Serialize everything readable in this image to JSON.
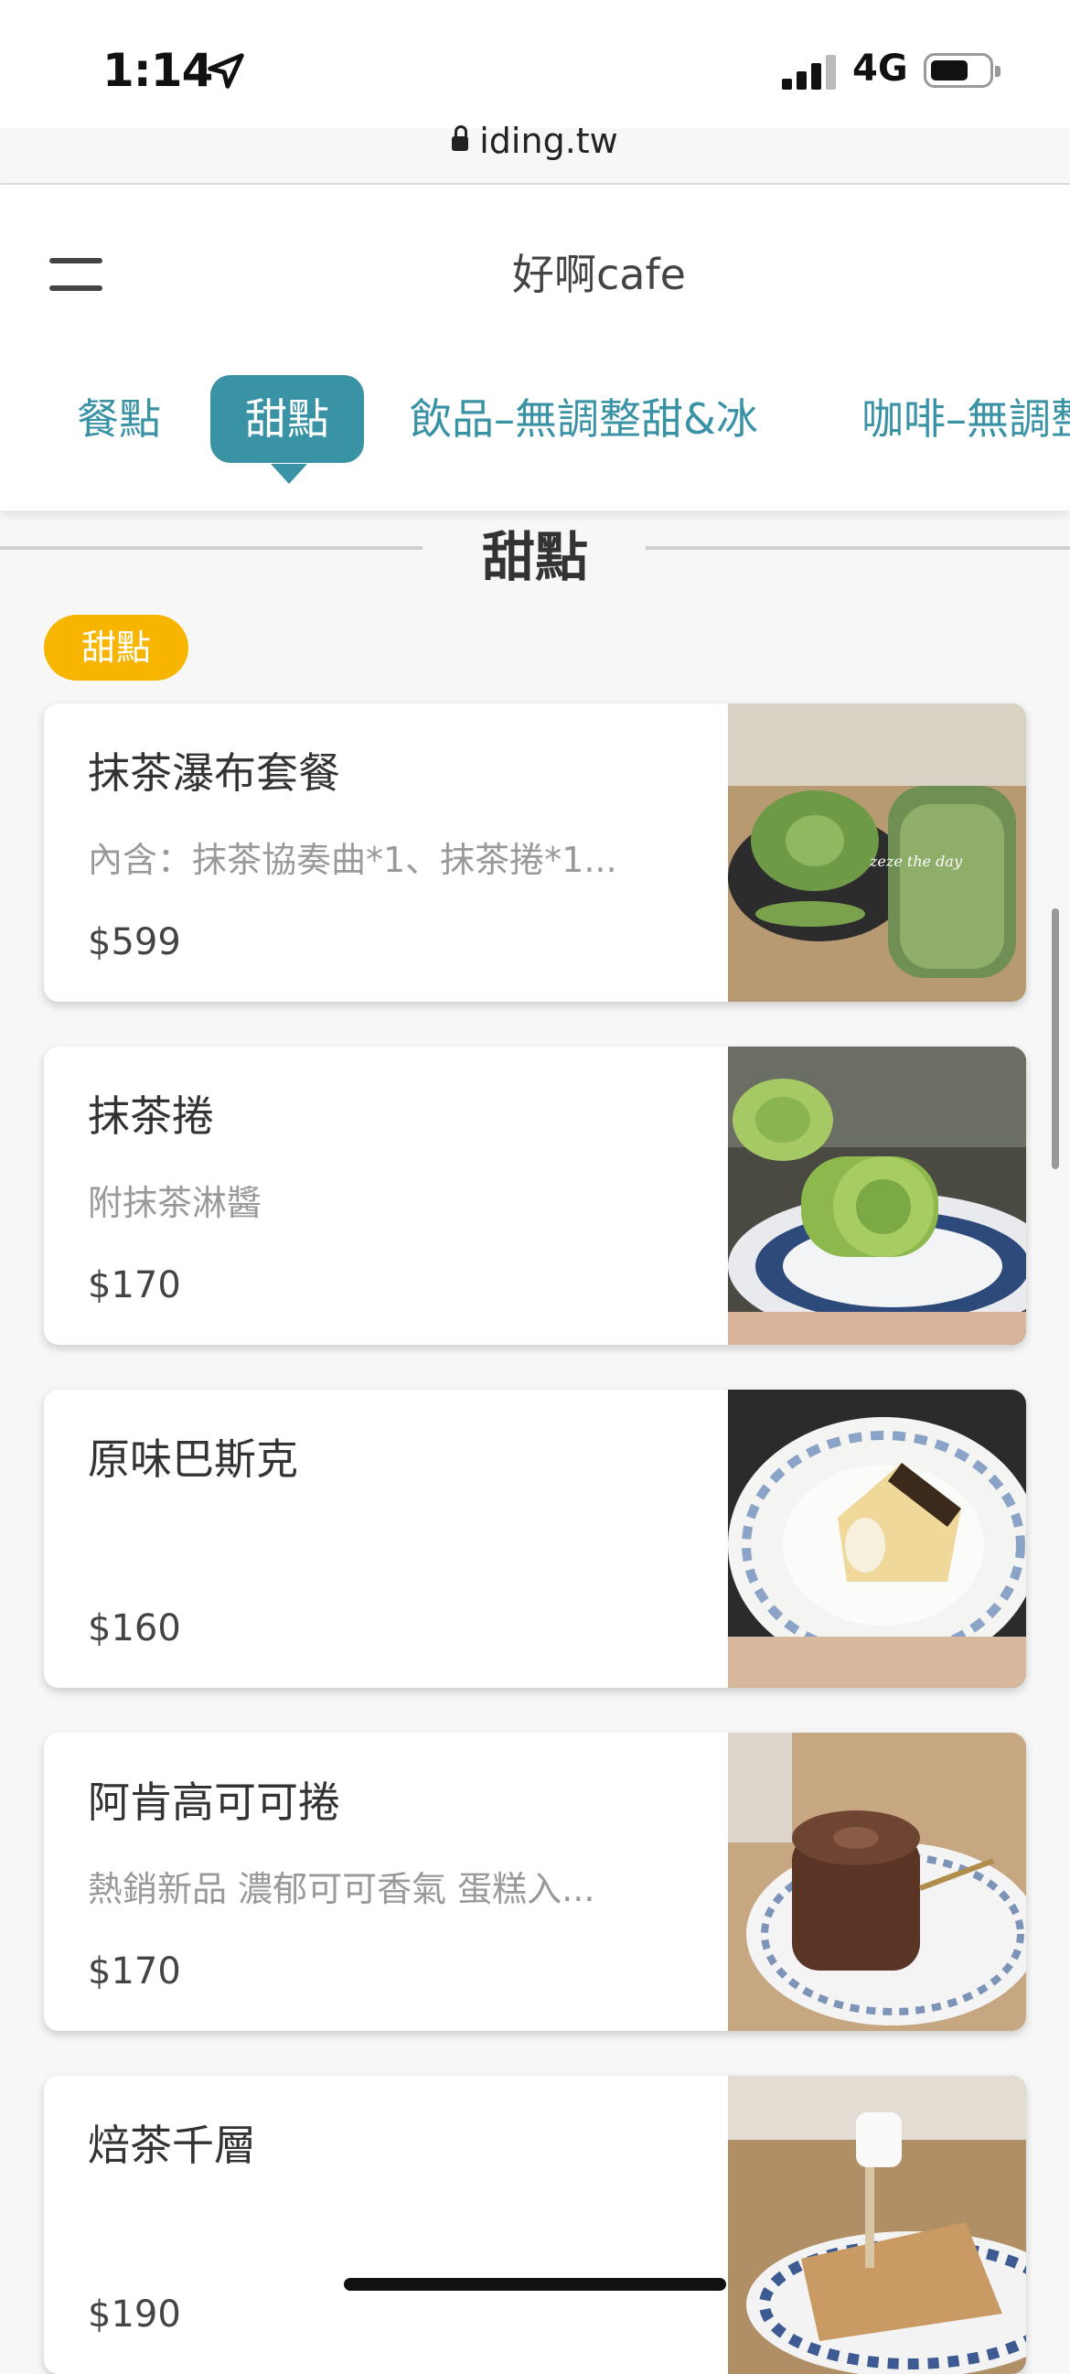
{
  "status_bar": {
    "time": "1:14",
    "network": "4G"
  },
  "browser": {
    "url": "iding.tw"
  },
  "header": {
    "title": "好啊cafe",
    "tabs": [
      {
        "label": "餐點"
      },
      {
        "label": "甜點"
      },
      {
        "label": "飲品–無調整甜&冰"
      },
      {
        "label": "咖啡–無調整"
      }
    ],
    "active_tab": "甜點"
  },
  "section": {
    "title": "甜點",
    "badge": "甜點"
  },
  "items": [
    {
      "name": "抹茶瀑布套餐",
      "desc": "內含：抹茶協奏曲*1、抹茶捲*1...",
      "price": "$599"
    },
    {
      "name": "抹茶捲",
      "desc": "附抹茶淋醬",
      "price": "$170"
    },
    {
      "name": "原味巴斯克",
      "desc": "",
      "price": "$160"
    },
    {
      "name": "阿肯高可可捲",
      "desc": "熱銷新品 濃郁可可香氣 蛋糕入...",
      "price": "$170"
    },
    {
      "name": "焙茶千層",
      "desc": "",
      "price": "$190"
    }
  ],
  "colors": {
    "accent": "#3a93a5",
    "badge": "#f7b500"
  }
}
